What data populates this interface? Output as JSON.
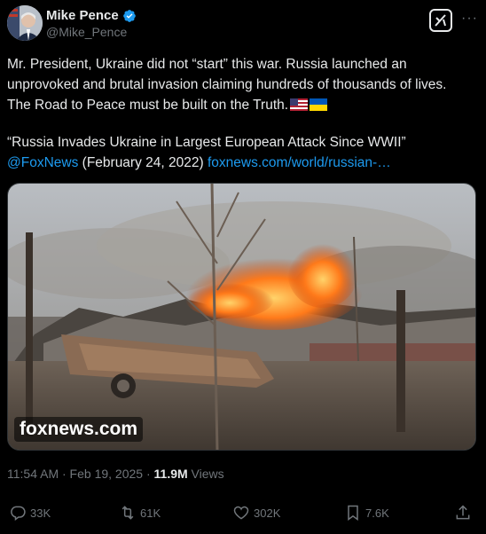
{
  "author": {
    "name": "Mike Pence",
    "handle": "@Mike_Pence",
    "verified": true
  },
  "tweet": {
    "line1": "Mr. President, Ukraine did not “start” this war. Russia launched an",
    "line2": "unprovoked and brutal invasion claiming hundreds of thousands of lives.",
    "line3": "The Road to Peace must be built on the Truth."
  },
  "quote": {
    "headline": "“Russia Invades Ukraine in Largest European Attack Since WWII”",
    "source_handle": "@FoxNews",
    "date": "(February 24, 2022)",
    "url": "foxnews.com/world/russian-…"
  },
  "media": {
    "watermark": "foxnews.com"
  },
  "meta": {
    "time": "11:54 AM · Feb 19, 2025 · ",
    "views_count": "11.9M",
    "views_label": " Views"
  },
  "actions": {
    "replies": "33K",
    "reposts": "61K",
    "likes": "302K",
    "bookmarks": "7.6K"
  },
  "colors": {
    "background": "#000000",
    "link": "#1d9bf0",
    "muted": "#71767b",
    "text": "#e7e9ea"
  },
  "icons": [
    "verified-badge-icon",
    "grok-icon",
    "more-icon",
    "reply-icon",
    "repost-icon",
    "like-icon",
    "bookmark-icon",
    "share-icon",
    "us-flag-icon",
    "ukraine-flag-icon"
  ]
}
